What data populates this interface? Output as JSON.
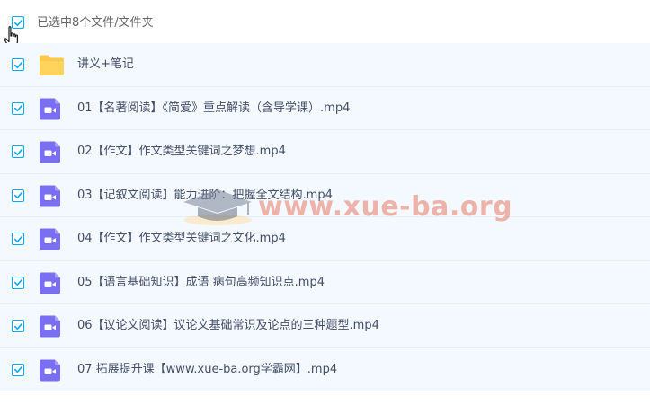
{
  "header": {
    "selection_text": "已选中8个文件/文件夹",
    "select_all_checked": true
  },
  "rows": [
    {
      "name": "讲义+笔记",
      "type": "folder",
      "checked": true
    },
    {
      "name": "01【名著阅读】《简爱》重点解读（含导学课）.mp4",
      "type": "video",
      "checked": true
    },
    {
      "name": "02【作文】作文类型关键词之梦想.mp4",
      "type": "video",
      "checked": true
    },
    {
      "name": "03【记叙文阅读】能力进阶：把握全文结构.mp4",
      "type": "video",
      "checked": true
    },
    {
      "name": "04【作文】作文类型关键词之文化.mp4",
      "type": "video",
      "checked": true
    },
    {
      "name": "05【语言基础知识】成语 病句高频知识点.mp4",
      "type": "video",
      "checked": true
    },
    {
      "name": "06【议论文阅读】议论文基础常识及论点的三种题型.mp4",
      "type": "video",
      "checked": true
    },
    {
      "name": "07 拓展提升课【www.xue-ba.org学霸网】.mp4",
      "type": "video",
      "checked": true
    }
  ],
  "watermark": {
    "text": "www.xue-ba.org",
    "icon": "graduation-cap-icon"
  },
  "colors": {
    "checkbox_accent": "#06a7ff",
    "row_background": "#f4f9ff",
    "folder": "#ffc746",
    "video": "#7a6ef2"
  }
}
